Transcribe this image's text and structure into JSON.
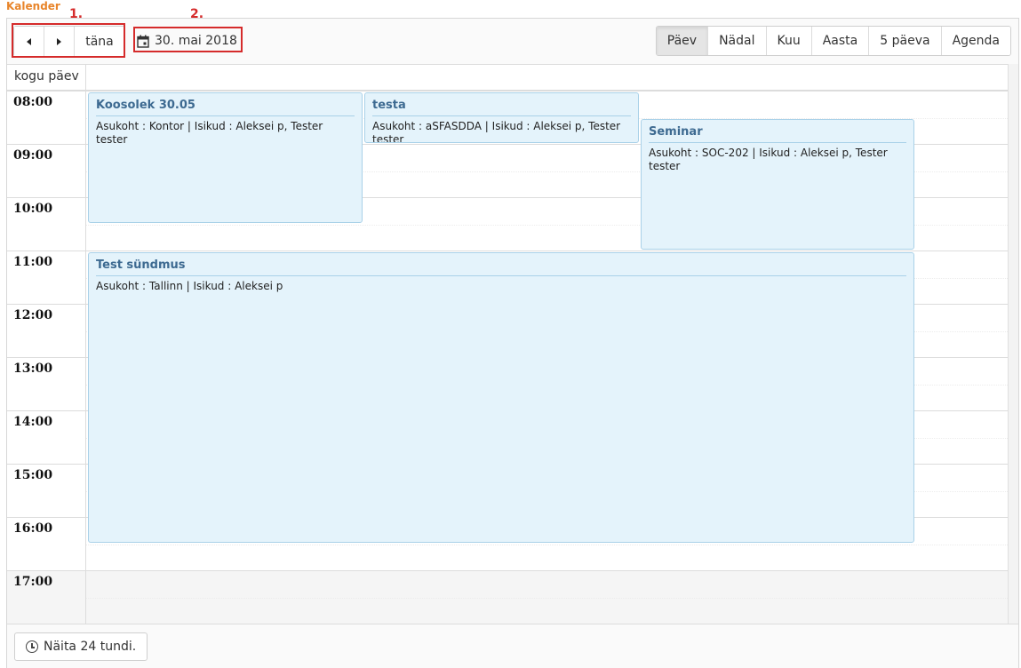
{
  "app": {
    "title": "Kalender"
  },
  "annotations": {
    "nav": "1.",
    "date": "2."
  },
  "toolbar": {
    "prev_label": "",
    "next_label": "",
    "today_label": "täna",
    "current_date": "30. mai 2018",
    "views": [
      {
        "label": "Päev",
        "active": true
      },
      {
        "label": "Nädal",
        "active": false
      },
      {
        "label": "Kuu",
        "active": false
      },
      {
        "label": "Aasta",
        "active": false
      },
      {
        "label": "5 päeva",
        "active": false
      },
      {
        "label": "Agenda",
        "active": false
      }
    ]
  },
  "allday": {
    "label": "kogu päev"
  },
  "hours": [
    "08:00",
    "09:00",
    "10:00",
    "11:00",
    "12:00",
    "13:00",
    "14:00",
    "15:00",
    "16:00",
    "17:00"
  ],
  "events": [
    {
      "title": "Koosolek 30.05",
      "description": "Asukoht : Kontor | Isikud : Aleksei p, Tester tester"
    },
    {
      "title": "testa",
      "description": "Asukoht : aSFASDDA | Isikud : Aleksei p, Tester tester"
    },
    {
      "title": "Seminar",
      "description": "Asukoht : SOC-202 | Isikud : Aleksei p, Tester tester"
    },
    {
      "title": "Test sündmus",
      "description": "Asukoht : Tallinn | Isikud : Aleksei p"
    }
  ],
  "footer": {
    "show24_label": "Näita 24 tundi."
  },
  "icons": {
    "prev": "caret-left-icon",
    "next": "caret-right-icon",
    "date": "calendar-icon",
    "show24": "clock-icon"
  },
  "colors": {
    "title": "#e8852b",
    "annotation": "#d52b2b",
    "event_bg": "#e4f3fb",
    "event_title": "#3d6a91"
  }
}
